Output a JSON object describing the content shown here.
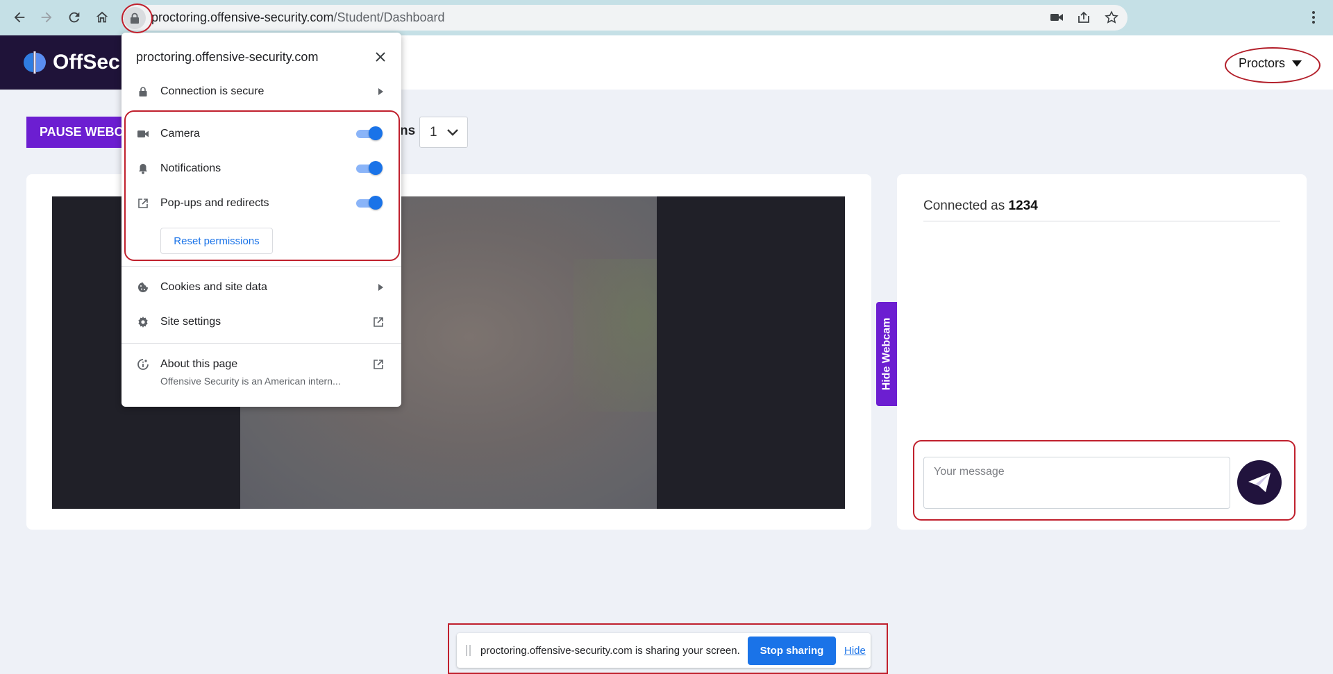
{
  "browser": {
    "url_host": "proctoring.offensive-security.com",
    "url_path": "/Student/Dashboard"
  },
  "header": {
    "brand": "OffSec",
    "proctors_label": "Proctors"
  },
  "controls": {
    "pause_label": "PAUSE WEBCAM",
    "cameras_label_fragment": "ns",
    "camera_selected": "1"
  },
  "webcam": {
    "hide_label": "Hide Webcam"
  },
  "chat": {
    "connected_prefix": "Connected as ",
    "connected_user": "1234",
    "message_placeholder": "Your message"
  },
  "screen_share": {
    "text": "proctoring.offensive-security.com is sharing your screen.",
    "stop_label": "Stop sharing",
    "hide_label": "Hide"
  },
  "site_popup": {
    "title": "proctoring.offensive-security.com",
    "connection": "Connection is secure",
    "permissions": [
      {
        "label": "Camera",
        "icon": "camera-icon",
        "enabled": true
      },
      {
        "label": "Notifications",
        "icon": "bell-icon",
        "enabled": true
      },
      {
        "label": "Pop-ups and redirects",
        "icon": "popup-icon",
        "enabled": true
      }
    ],
    "reset_label": "Reset permissions",
    "cookies": "Cookies and site data",
    "site_settings": "Site settings",
    "about_title": "About this page",
    "about_sub": "Offensive Security is an American intern..."
  },
  "colors": {
    "accent_purple": "#6c1ed1",
    "brand_dark": "#1f1339",
    "chrome_blue": "#1a73e8",
    "annotation_red": "#c0202d"
  }
}
